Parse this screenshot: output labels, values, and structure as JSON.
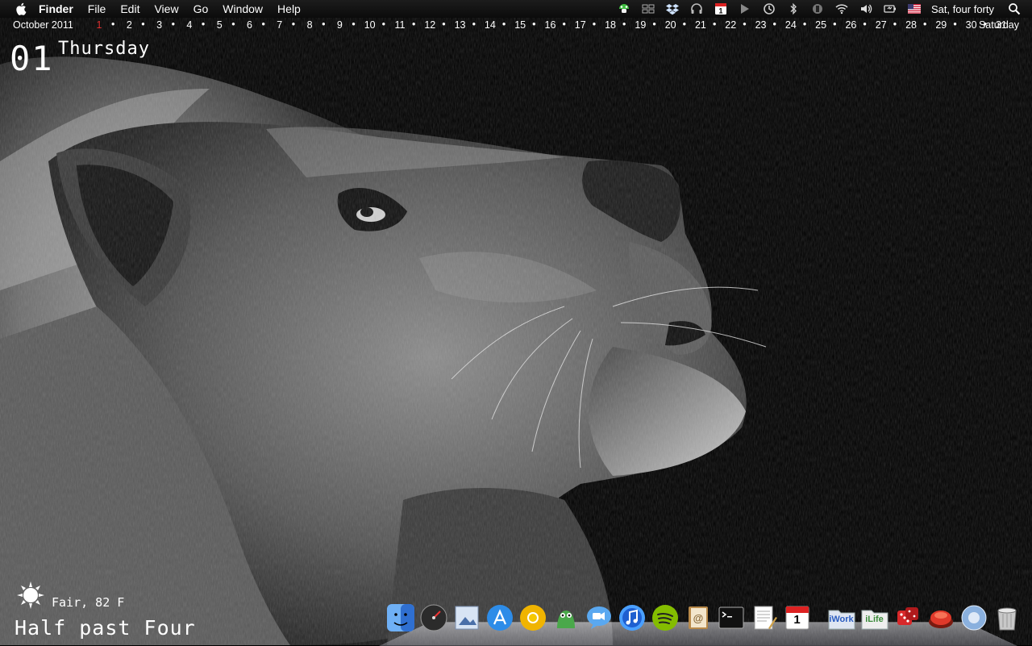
{
  "menubar": {
    "apple_icon": "apple-logo-icon",
    "app_name": "Finder",
    "items": [
      "File",
      "Edit",
      "View",
      "Go",
      "Window",
      "Help"
    ],
    "status_icons": [
      "mushroom-icon",
      "spaces-icon",
      "dropbox-icon",
      "headphones-icon",
      "calendar-icon",
      "growl-icon",
      "time-machine-icon",
      "bluetooth-icon",
      "sync-icon",
      "wifi-icon",
      "volume-icon",
      "battery-icon",
      "us-flag-icon"
    ],
    "calendar_icon_day": "1",
    "clock": "Sat, four forty",
    "search_icon": "spotlight-icon"
  },
  "calendar_strip": {
    "month_label": "October 2011",
    "days": [
      "1",
      "2",
      "3",
      "4",
      "5",
      "6",
      "7",
      "8",
      "9",
      "10",
      "11",
      "12",
      "13",
      "14",
      "15",
      "16",
      "17",
      "18",
      "19",
      "20",
      "21",
      "22",
      "23",
      "24",
      "25",
      "26",
      "27",
      "28",
      "29",
      "30",
      "31"
    ],
    "today": "1",
    "separator": "•",
    "weekday": "Saturday",
    "today_color": "#e03030"
  },
  "overlay": {
    "date_number": "01",
    "day_name": "Thursday",
    "weather": "Fair, 82 F",
    "weather_icon": "sun-icon",
    "time_words": "Half past Four"
  },
  "dock": {
    "items": [
      {
        "name": "finder-icon",
        "color": "#3a7fd8"
      },
      {
        "name": "dashboard-icon",
        "color": "#2c2c2c"
      },
      {
        "name": "preview-icon",
        "color": "#6a8fc0"
      },
      {
        "name": "app-store-icon",
        "color": "#2d8ce8"
      },
      {
        "name": "chrome-canary-icon",
        "color": "#f0b400"
      },
      {
        "name": "adium-icon",
        "color": "#3a8f3a"
      },
      {
        "name": "ichat-icon",
        "color": "#3c8ee8"
      },
      {
        "name": "itunes-icon",
        "color": "#2d6fd0"
      },
      {
        "name": "spotify-icon",
        "color": "#84bd00"
      },
      {
        "name": "address-book-icon",
        "color": "#b98a4a"
      },
      {
        "name": "terminal-icon",
        "color": "#1a1a1a"
      },
      {
        "name": "textedit-icon",
        "color": "#e8e8e8"
      },
      {
        "name": "ical-icon",
        "color": "#f4f4f4"
      },
      {
        "name": "iwork-folder-icon",
        "color": "#e0e6f0"
      },
      {
        "name": "ilife-folder-icon",
        "color": "#e8e8e8"
      },
      {
        "name": "dice-app-icon",
        "color": "#d8282a"
      },
      {
        "name": "red-button-app-icon",
        "color": "#cc2a1e"
      },
      {
        "name": "downloads-stack-icon",
        "color": "#5a7aa8"
      },
      {
        "name": "trash-icon",
        "color": "#9a9a9a"
      }
    ],
    "ical_day": "1",
    "iwork_label": "iWork",
    "ilife_label": "iLife"
  }
}
